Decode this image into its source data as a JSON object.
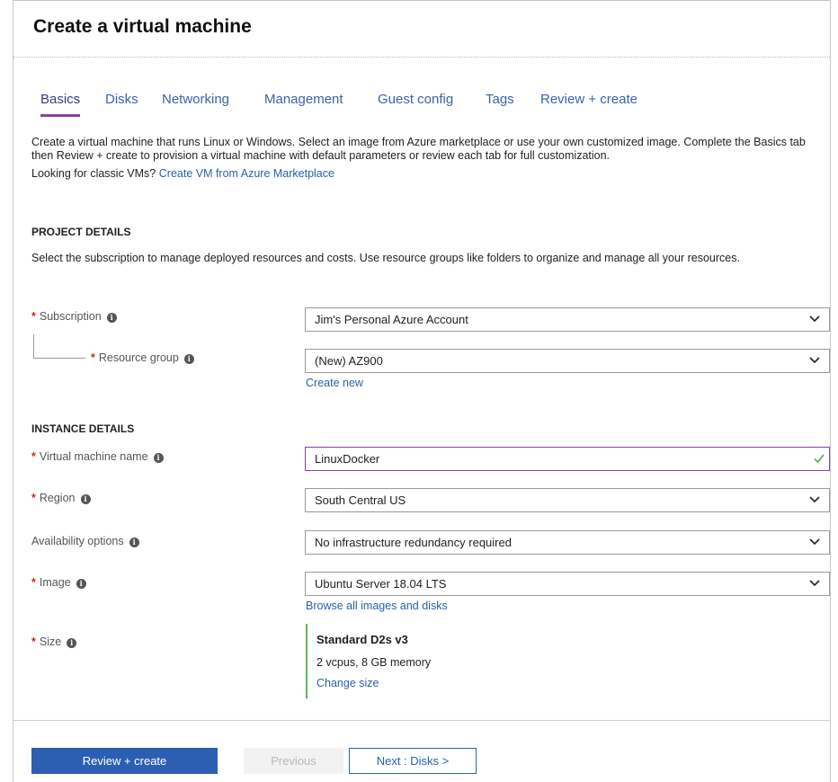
{
  "page": {
    "title": "Create a virtual machine"
  },
  "tabs": [
    {
      "label": "Basics",
      "active": true
    },
    {
      "label": "Disks"
    },
    {
      "label": "Networking"
    },
    {
      "label": "Management"
    },
    {
      "label": "Guest config"
    },
    {
      "label": "Tags"
    },
    {
      "label": "Review + create"
    }
  ],
  "intro": {
    "text": "Create a virtual machine that runs Linux or Windows. Select an image from Azure marketplace or use your own customized image. Complete the Basics tab then Review + create to provision a virtual machine with default parameters or review each tab for full customization.",
    "classic_prefix": "Looking for classic VMs?",
    "classic_link": "Create VM from Azure Marketplace"
  },
  "project": {
    "heading": "PROJECT DETAILS",
    "description": "Select the subscription to manage deployed resources and costs. Use resource groups like folders to organize and manage all your resources.",
    "subscription_label": "Subscription",
    "subscription_value": "Jim's Personal Azure Account",
    "resource_group_label": "Resource group",
    "resource_group_value": "(New) AZ900",
    "create_new_link": "Create new"
  },
  "instance": {
    "heading": "INSTANCE DETAILS",
    "vm_name_label": "Virtual machine name",
    "vm_name_value": "LinuxDocker",
    "region_label": "Region",
    "region_value": "South Central US",
    "availability_label": "Availability options",
    "availability_value": "No infrastructure redundancy required",
    "image_label": "Image",
    "image_value": "Ubuntu Server 18.04 LTS",
    "browse_link": "Browse all images and disks",
    "size_label": "Size",
    "size_name": "Standard D2s v3",
    "size_spec": "2 vcpus, 8 GB memory",
    "change_size_link": "Change size"
  },
  "footer": {
    "review_create": "Review + create",
    "previous": "Previous",
    "next": "Next : Disks >"
  },
  "colors": {
    "accent": "#2c5fb3",
    "active_tab_underline": "#8c3fa6",
    "required": "#c42b1c",
    "valid": "#5cb85c"
  },
  "icons": {
    "info": "info-icon",
    "chevron": "chevron-down-icon",
    "valid": "checkmark-icon"
  }
}
